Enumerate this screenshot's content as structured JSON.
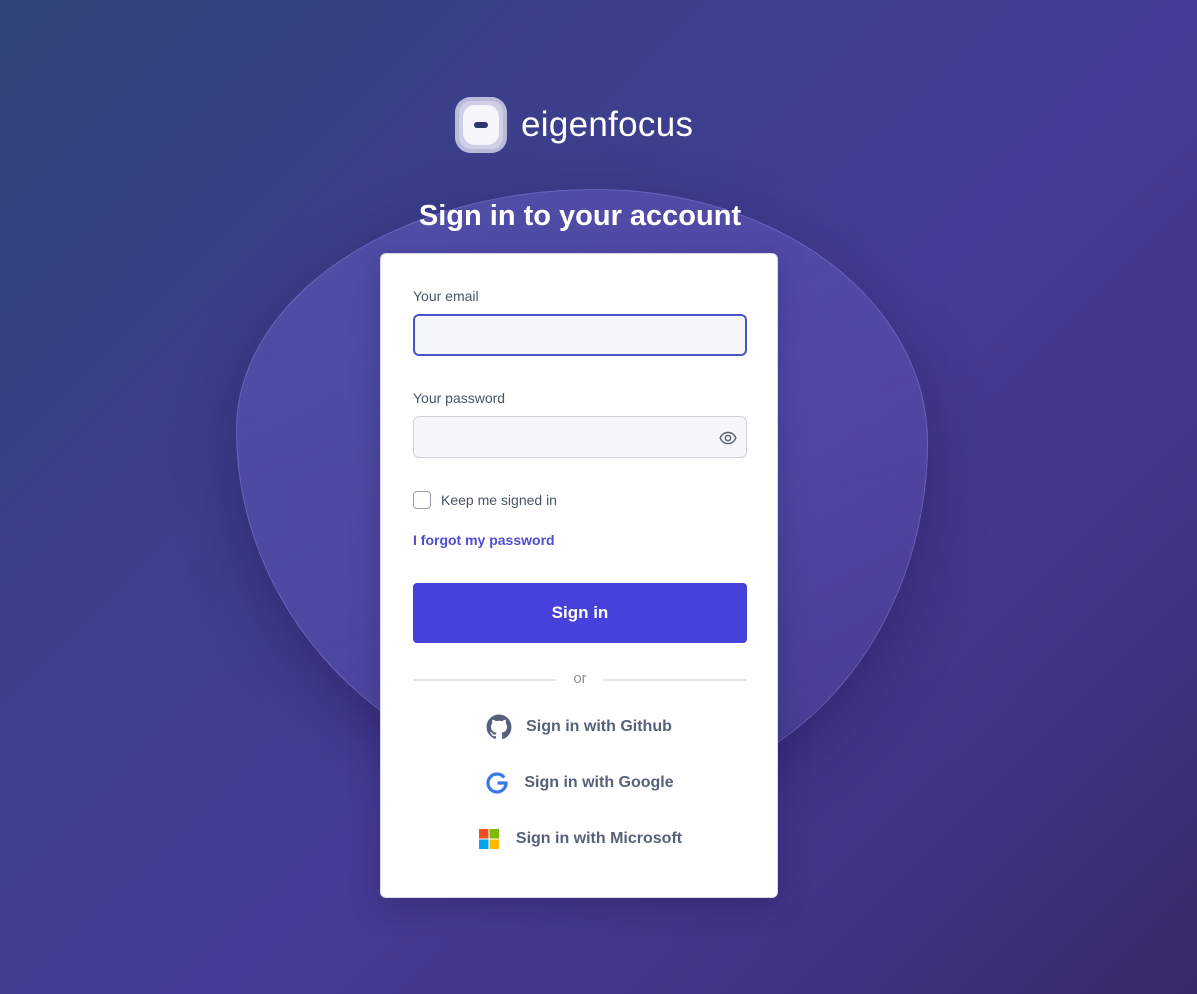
{
  "brand": {
    "name": "eigenfocus"
  },
  "page": {
    "heading": "Sign in to your account"
  },
  "form": {
    "email_label": "Your email",
    "email_value": "",
    "password_label": "Your password",
    "password_value": "",
    "keep_signed_in_label": "Keep me signed in",
    "keep_signed_in_checked": false,
    "forgot_password": "I forgot my password",
    "submit_label": "Sign in",
    "divider_text": "or"
  },
  "social_logins": [
    {
      "label": "Sign in with Github",
      "icon": "github-icon"
    },
    {
      "label": "Sign in with Google",
      "icon": "google-icon"
    },
    {
      "label": "Sign in with Microsoft",
      "icon": "microsoft-icon"
    }
  ],
  "colors": {
    "accent": "#4741db",
    "link": "#4f4ccf",
    "background_start": "#2e4476",
    "background_end": "#372a66"
  }
}
